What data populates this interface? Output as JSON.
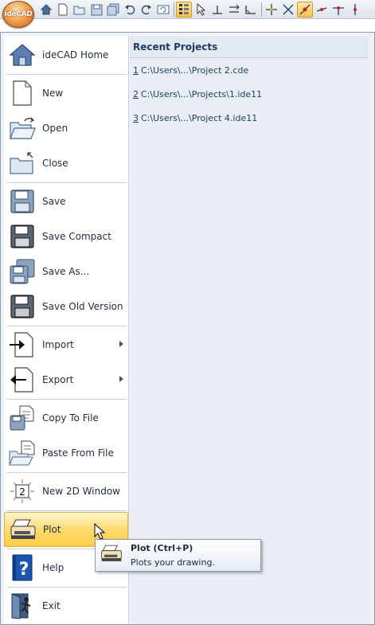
{
  "app_button": {
    "label": "ideCAD"
  },
  "toolbar": {
    "icons": [
      "home-icon",
      "new-file-icon",
      "open-folder-icon",
      "save-icon",
      "save-all-icon",
      "undo-icon",
      "redo-icon",
      "refresh-view-icon",
      "layers-icon",
      "cursor-snap-icon",
      "snap-perpendicular-icon",
      "snap-parallel-icon",
      "snap-angle-icon",
      "grid-snap-icon",
      "snap-midpoint-icon",
      "snap-intersection-icon",
      "snap-end-icon",
      "snap-center-icon",
      "snap-nearest-icon"
    ]
  },
  "menu": {
    "items": [
      {
        "label": "ideCAD Home"
      },
      {
        "label": "New"
      },
      {
        "label": "Open"
      },
      {
        "label": "Close"
      },
      {
        "label": "Save"
      },
      {
        "label": "Save Compact"
      },
      {
        "label": "Save As..."
      },
      {
        "label": "Save Old Version"
      },
      {
        "label": "Import"
      },
      {
        "label": "Export"
      },
      {
        "label": "Copy To File"
      },
      {
        "label": "Paste From File"
      },
      {
        "label": "New 2D Window"
      },
      {
        "label": "Plot"
      },
      {
        "label": "Help"
      },
      {
        "label": "Exit"
      }
    ]
  },
  "recent": {
    "header": "Recent Projects",
    "items": [
      {
        "num": "1",
        "path": "C:\\Users\\...\\Project 2.cde"
      },
      {
        "num": "2",
        "path": "C:\\Users\\...\\Projects\\1.ide11"
      },
      {
        "num": "3",
        "path": "C:\\Users\\...\\Project 4.ide11"
      }
    ]
  },
  "tooltip": {
    "title": "Plot (Ctrl+P)",
    "description": "Plots your drawing."
  },
  "colors": {
    "hover_bg": "#ffd96b",
    "accent_orange": "#f1a24a",
    "panel_bg": "#e9eef5"
  }
}
